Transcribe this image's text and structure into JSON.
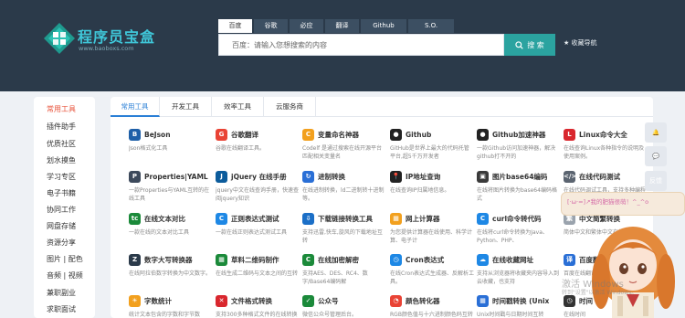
{
  "logo": {
    "title": "程序员宝盒",
    "subtitle": "www.baoboxs.com"
  },
  "search": {
    "tabs": [
      "百度",
      "谷歌",
      "必应",
      "翻译",
      "Github",
      "S.O."
    ],
    "placeholder": "百度：请输入您想搜索的内容",
    "button_label": "搜 索",
    "fav_nav_label": "收藏导航"
  },
  "sidebar": {
    "items": [
      "常用工具",
      "插件助手",
      "优质社区",
      "划水摸鱼",
      "学习专区",
      "电子书籍",
      "协同工作",
      "网盘存储",
      "资源分享",
      "图片 | 配色",
      "音频 | 视频",
      "兼职副业",
      "求职面试"
    ]
  },
  "content_tabs": [
    "常用工具",
    "开发工具",
    "效率工具",
    "云服务商"
  ],
  "tools": [
    {
      "name": "BeJson",
      "desc": "Json格式化工具",
      "icon": "bejson-icon",
      "color": "#1e5fa8",
      "glyph": "B"
    },
    {
      "name": "谷歌翻译",
      "desc": "谷歌在线翻译工具。",
      "icon": "google-translate-icon",
      "color": "#e94335",
      "glyph": "G"
    },
    {
      "name": "变量命名神器",
      "desc": "Codelf 是通过搜索在线开源平台匹配相关变量名",
      "icon": "codelf-icon",
      "color": "#f2a01e",
      "glyph": "C"
    },
    {
      "name": "Github",
      "desc": "GitHub是世界上最大的代码托管平台,超5千万开发者",
      "icon": "github-icon",
      "color": "#222222",
      "glyph": "●"
    },
    {
      "name": "Github加速神器",
      "desc": "一款Github访问加速神器，解决github打不开的",
      "icon": "github-accel-icon",
      "color": "#222222",
      "glyph": "●"
    },
    {
      "name": "Linux命令大全",
      "desc": "在线查询Linux各种指令的说明及使用案例。",
      "icon": "linux-icon",
      "color": "#d9272e",
      "glyph": "L"
    },
    {
      "name": "Properties|YAML",
      "desc": "一款Properties与YAML互转的在线工具",
      "icon": "properties-yaml-icon",
      "color": "#3d4a5c",
      "glyph": "P"
    },
    {
      "name": "jQuery 在线手册",
      "desc": "jquery中文在线查询手册，快速查阅jquery知识",
      "icon": "jquery-icon",
      "color": "#0c5c9c",
      "glyph": "J"
    },
    {
      "name": "进制转换",
      "desc": "在线进制转换，ld二进制转十进制等。",
      "icon": "radix-icon",
      "color": "#2a6fd6",
      "glyph": "↻"
    },
    {
      "name": "IP地址查询",
      "desc": "在线查询IP归属地信息。",
      "icon": "ip-icon",
      "color": "#222222",
      "glyph": "📍"
    },
    {
      "name": "图片base64编码",
      "desc": "在线将图片转换为base64编码格式",
      "icon": "base64-image-icon",
      "color": "#3a3a3a",
      "glyph": "▣"
    },
    {
      "name": "在线代码测试",
      "desc": "在线代码调试工具，支持多种编程语言。",
      "icon": "code-test-icon",
      "color": "#5b6470",
      "glyph": "</>"
    },
    {
      "name": "在线文本对比",
      "desc": "一款在线的文本对比工具",
      "icon": "text-diff-icon",
      "color": "#1b8a3a",
      "glyph": "tc"
    },
    {
      "name": "正则表达式测试",
      "desc": "一款在线正则表达式测试工具",
      "icon": "regex-icon",
      "color": "#1e88e5",
      "glyph": "C"
    },
    {
      "name": "下载链接转换工具",
      "desc": "支持迅雷,快车,旋风的下载地址互转",
      "icon": "download-link-icon",
      "color": "#1b6fc7",
      "glyph": "⇩"
    },
    {
      "name": "网上计算器",
      "desc": "为您提供计算器在线使用、科学计算、电子计",
      "icon": "calculator-icon",
      "color": "#f2a01e",
      "glyph": "▦"
    },
    {
      "name": "curl命令转代码",
      "desc": "在线将curl命令转换为Java、Python、PHP、",
      "icon": "curl-icon",
      "color": "#1e88e5",
      "glyph": "C"
    },
    {
      "name": "中文简繁转换",
      "desc": "简体中文和繁体中文在线转换",
      "icon": "chinese-convert-icon",
      "color": "#9aa3ad",
      "glyph": "繁"
    },
    {
      "name": "数字大写转换器",
      "desc": "在线阿拉伯数字转换为中文数字。",
      "icon": "number-upper-icon",
      "color": "#2b3a4a",
      "glyph": "Z"
    },
    {
      "name": "草料二维码制作",
      "desc": "在线生成二维码与文本之间的互转",
      "icon": "qrcode-icon",
      "color": "#1b8a3a",
      "glyph": "▦"
    },
    {
      "name": "在线加密解密",
      "desc": "支持AES、DES、RC4、数字/Base64编码解",
      "icon": "crypto-icon",
      "color": "#1b8a3a",
      "glyph": "C"
    },
    {
      "name": "Cron表达式",
      "desc": "在线Cron表达式生成器、反解析工具。",
      "icon": "cron-icon",
      "color": "#1e88e5",
      "glyph": "◷"
    },
    {
      "name": "在线收藏网址",
      "desc": "支持从浏览器将收藏夹内容导入到云收藏，也支持",
      "icon": "bookmark-icon",
      "color": "#1e88e5",
      "glyph": "☁"
    },
    {
      "name": "百度翻译",
      "desc": "百度在线翻译工具",
      "icon": "baidu-translate-icon",
      "color": "#2a6fd6",
      "glyph": "译"
    },
    {
      "name": "字数统计",
      "desc": "统计文本包含的字数和字节数",
      "icon": "word-count-icon",
      "color": "#f2a01e",
      "glyph": "☀"
    },
    {
      "name": "文件格式转换",
      "desc": "支持300多种格式文件的在线转换",
      "icon": "file-convert-icon",
      "color": "#d9272e",
      "glyph": "✕"
    },
    {
      "name": "公众号",
      "desc": "微信公众号管理后台。",
      "icon": "wechat-mp-icon",
      "color": "#1b8a3a",
      "glyph": "✓"
    },
    {
      "name": "颜色转化器",
      "desc": "RGB颜色值与十六进制颜色码互转",
      "icon": "color-convert-icon",
      "color": "#e94335",
      "glyph": "◔"
    },
    {
      "name": "时间戳转换 (Unix",
      "desc": "Unix时间戳与日期时间互转",
      "icon": "timestamp-icon",
      "color": "#2a6fd6",
      "glyph": "▦"
    },
    {
      "name": "时间",
      "desc": "在线时间",
      "icon": "clock-icon",
      "color": "#333333",
      "glyph": "◷"
    }
  ],
  "floating": {
    "buttons": [
      "🔔",
      "💬",
      "反馈"
    ],
    "bubble": "[·ω·=]↗我的肥猫很萌！^_^o",
    "watermark": "激活 Windows",
    "watermark_sub": "转到\"设置\"以激活 Windows。"
  }
}
